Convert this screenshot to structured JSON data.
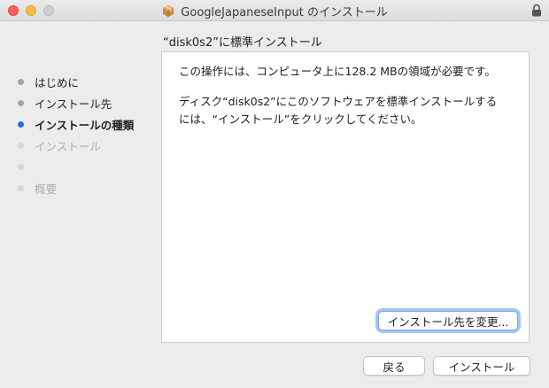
{
  "window": {
    "title": "GoogleJapaneseInput のインストール",
    "icons": {
      "app": "package-icon",
      "lock": "lock-icon"
    }
  },
  "header": {
    "subtitle": "“disk0s2”に標準インストール"
  },
  "sidebar": {
    "steps": [
      {
        "label": "はじめに",
        "state": "done"
      },
      {
        "label": "インストール先",
        "state": "done"
      },
      {
        "label": "インストールの種類",
        "state": "current"
      },
      {
        "label": "インストール",
        "state": "future"
      },
      {
        "label": "",
        "state": "future"
      },
      {
        "label": "概要",
        "state": "future"
      }
    ]
  },
  "content": {
    "line1": "この操作には、コンピュータ上に128.2 MBの領域が必要です。",
    "line2": "ディスク“disk0s2”にこのソフトウェアを標準インストールするには、“インストール”をクリックしてください。"
  },
  "buttons": {
    "change_location": "インストール先を変更...",
    "back": "戻る",
    "install": "インストール"
  },
  "colors": {
    "accent": "#1e6fe0",
    "close": "#fc605c",
    "minimize": "#fdbc40",
    "zoom_disabled": "#d0d0d0"
  }
}
